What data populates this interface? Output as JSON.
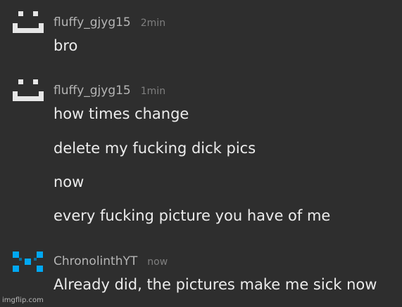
{
  "messages": [
    {
      "author": "fluffy_gjyg15",
      "time": "2min",
      "avatar_icon": "white-pixel-smiley-avatar-icon",
      "lines": [
        "bro"
      ]
    },
    {
      "author": "fluffy_gjyg15",
      "time": "1min",
      "avatar_icon": "white-pixel-smiley-avatar-icon",
      "lines": [
        "how times change",
        "delete my fucking dick pics",
        "now",
        "every fucking picture you have of me"
      ]
    },
    {
      "author": "ChronolinthYT",
      "time": "now",
      "avatar_icon": "blue-pixel-avatar-icon",
      "lines": [
        "Already did, the pictures make me sick now"
      ]
    }
  ],
  "watermark": "imgflip.com",
  "colors": {
    "background": "#2e2e2e",
    "author": "#b5b5b5",
    "timestamp": "#7f7f7f",
    "message_text": "#ececec",
    "avatar_white": "#e6e6e6",
    "avatar_blue": "#00a8f3"
  }
}
